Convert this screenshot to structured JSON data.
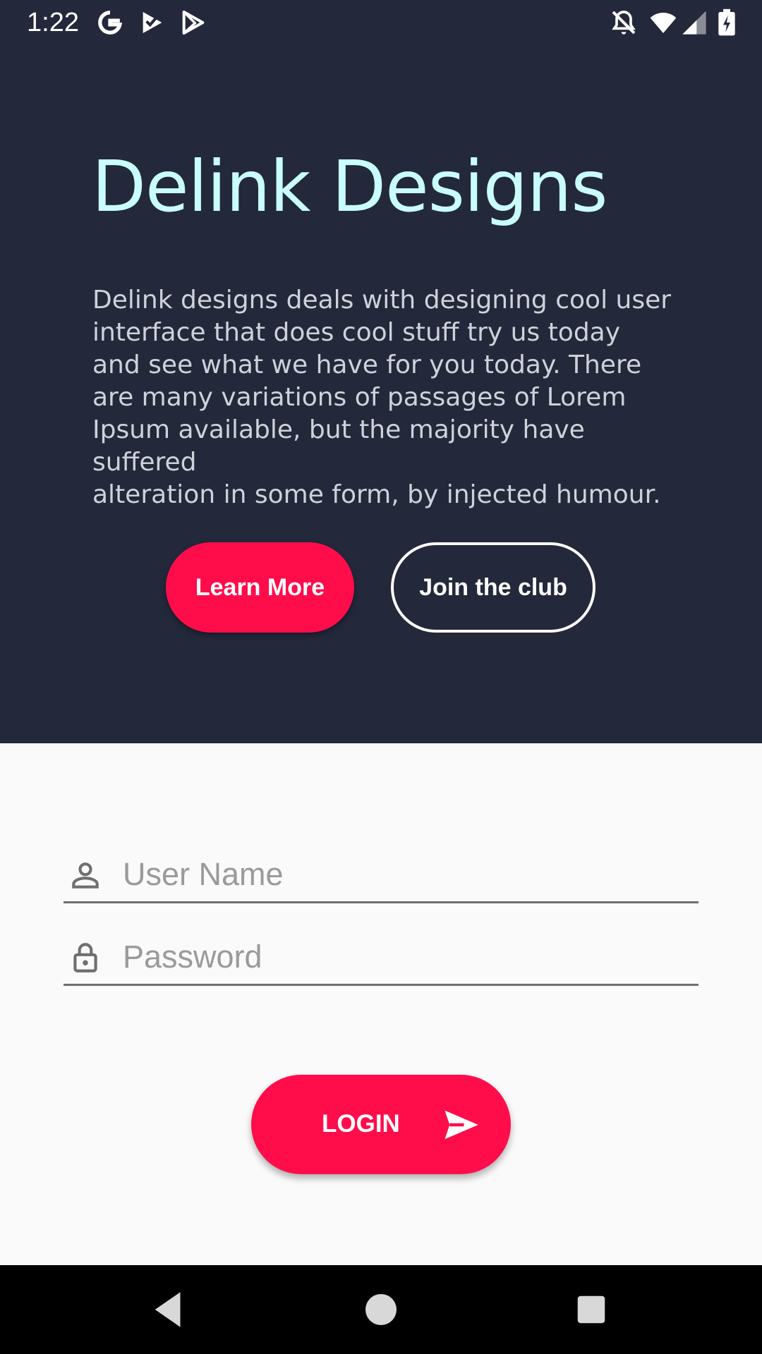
{
  "status_bar": {
    "time": "1:22",
    "icons": [
      "google-icon",
      "tasks-icon",
      "play-store-icon",
      "notifications-off-icon",
      "wifi-icon",
      "cell-signal-icon",
      "battery-charging-icon"
    ]
  },
  "hero": {
    "title": "Delink Designs",
    "description": "Delink designs deals with designing cool user\ninterface that does cool stuff try us today\nand see what we have for you today. There\nare many variations of passages of Lorem\nIpsum available, but the majority have suffered\nalteration in some form, by injected humour.",
    "learn_more_label": "Learn More",
    "join_label": "Join the club"
  },
  "form": {
    "username_placeholder": "User Name",
    "password_placeholder": "Password",
    "login_label": "LOGIN"
  },
  "nav_bar": {
    "buttons": [
      "back-icon",
      "home-icon",
      "recents-icon"
    ]
  },
  "colors": {
    "hero_background": "#23283b",
    "title": "#c9fdfc",
    "accent": "#ff0d4b",
    "form_background": "#fafafa",
    "nav_background": "#000000"
  }
}
